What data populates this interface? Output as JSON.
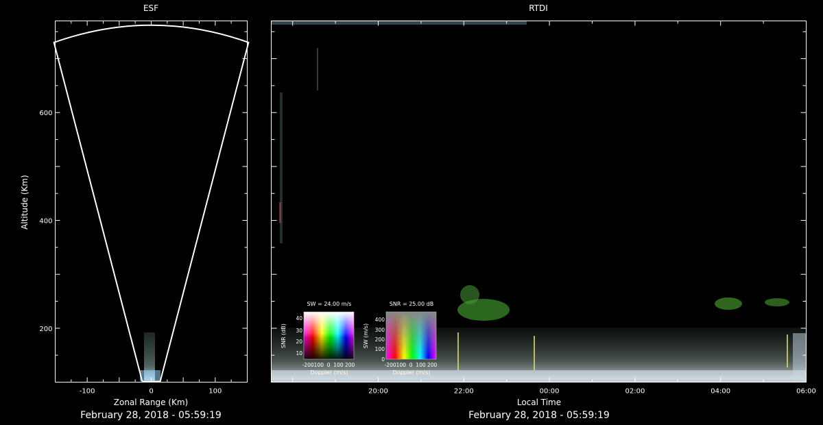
{
  "chart_data": [
    {
      "type": "heatmap",
      "title": "ESF",
      "xlabel": "Zonal Range (Km)",
      "ylabel": "Altitude (Km)",
      "xlim": [
        -150,
        150
      ],
      "ylim": [
        100,
        770
      ],
      "xticks": [
        -100,
        0,
        100
      ],
      "yticks": [
        200,
        400,
        600
      ],
      "footer": "February 28, 2018 - 05:59:19",
      "fan_half_width_km": 152,
      "fan_top_km": 770
    },
    {
      "type": "heatmap",
      "title": "RTDI",
      "xlabel": "Local Time",
      "xlim": [
        17.5,
        30
      ],
      "ylim": [
        100,
        770
      ],
      "xticks": [
        {
          "value": 20,
          "label": "20:00"
        },
        {
          "value": 22,
          "label": "22:00"
        },
        {
          "value": 24,
          "label": "00:00"
        },
        {
          "value": 26,
          "label": "02:00"
        },
        {
          "value": 28,
          "label": "04:00"
        },
        {
          "value": 30,
          "label": "06:00"
        }
      ],
      "footer": "February 28, 2018 - 05:59:19"
    }
  ],
  "legends": {
    "sw_key": {
      "title": "SW = 24.00 m/s",
      "ylabel": "SNR (dB)",
      "xlabel": "Doppler (m/s)",
      "yticks": [
        "40",
        "30",
        "20",
        "10"
      ],
      "xticks": "-200100  0  100 200"
    },
    "snr_key": {
      "title": "SNR = 25.00 dB",
      "ylabel": "SW (m/s)",
      "xlabel": "Doppler (m/s)",
      "yticks": [
        "400",
        "300",
        "200",
        "100",
        "0"
      ],
      "xticks": "-200100  0  100 200"
    }
  }
}
